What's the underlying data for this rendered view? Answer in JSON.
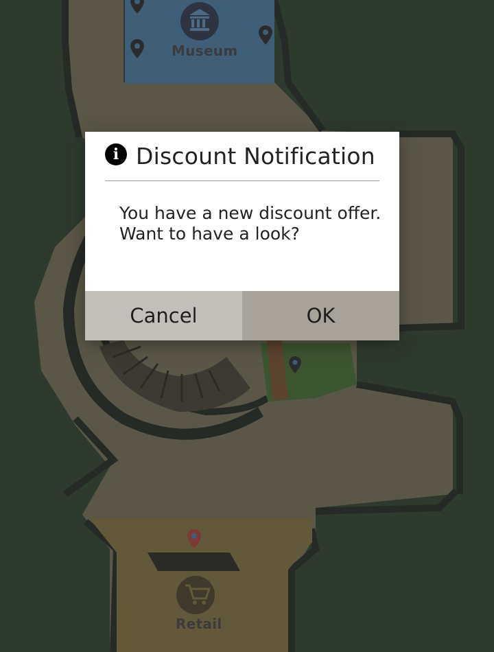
{
  "map": {
    "labels": {
      "museum": "Museum",
      "retail": "Retail"
    },
    "colors": {
      "background": "#2f3a2f",
      "floor": "#5a5748",
      "wall": "#262a26",
      "museum_zone": "#3f5f79",
      "green_zone": "#3d5432",
      "retail_zone": "#62583a",
      "pin": "#2c2c2c",
      "pin_highlight": "#7b3a36"
    },
    "icons": [
      "museum-icon",
      "cart-icon",
      "map-pin-icon"
    ]
  },
  "dialog": {
    "icon": "info-icon",
    "icon_glyph": "i",
    "title": "Discount Notification",
    "message_line1": "You have a new discount offer.",
    "message_line2": "Want to have a look?",
    "cancel_label": "Cancel",
    "ok_label": "OK",
    "colors": {
      "cancel_bg": "#c3c0bb",
      "ok_bg": "#a7a39b"
    }
  }
}
